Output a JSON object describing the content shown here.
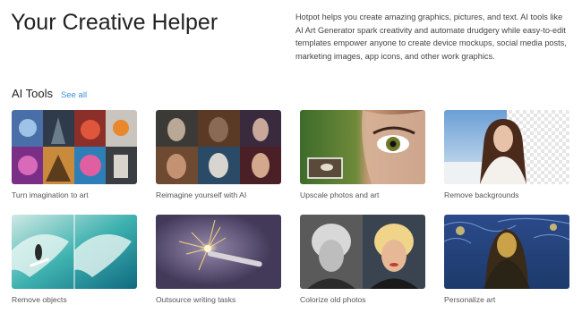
{
  "hero": {
    "title": "Your Creative Helper",
    "description": "Hotpot helps you create amazing graphics, pictures, and text. AI tools like AI Art Generator spark creativity and automate drudgery while easy-to-edit templates empower anyone to create device mockups, social media posts, marketing images, app icons, and other work graphics."
  },
  "tools": {
    "heading": "AI Tools",
    "see_all": "See all",
    "cards": [
      {
        "label": "Turn imagination to art"
      },
      {
        "label": "Reimagine yourself with AI"
      },
      {
        "label": "Upscale photos and art"
      },
      {
        "label": "Remove backgrounds"
      },
      {
        "label": "Remove objects"
      },
      {
        "label": "Outsource writing tasks"
      },
      {
        "label": "Colorize old photos"
      },
      {
        "label": "Personalize art"
      }
    ]
  }
}
